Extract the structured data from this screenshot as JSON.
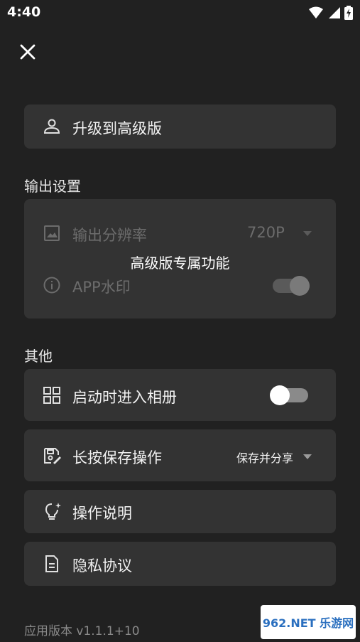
{
  "status": {
    "time": "4:40"
  },
  "upgrade": {
    "label": "升级到高级版"
  },
  "output_settings": {
    "heading": "输出设置",
    "resolution_label": "输出分辨率",
    "resolution_value": "720P",
    "watermark_label": "APP水印",
    "watermark_on": true,
    "locked_overlay": "高级版专属功能"
  },
  "other": {
    "heading": "其他",
    "open_album_label": "启动时进入相册",
    "open_album_on": false,
    "long_press_label": "长按保存操作",
    "long_press_value": "保存并分享",
    "instructions_label": "操作说明",
    "privacy_label": "隐私协议"
  },
  "version": "应用版本 v1.1.1+10",
  "watermark_logo": "962.NET 乐游网",
  "colors": {
    "background": "#212121",
    "card": "#333333",
    "dim": "#6c6c6c"
  }
}
